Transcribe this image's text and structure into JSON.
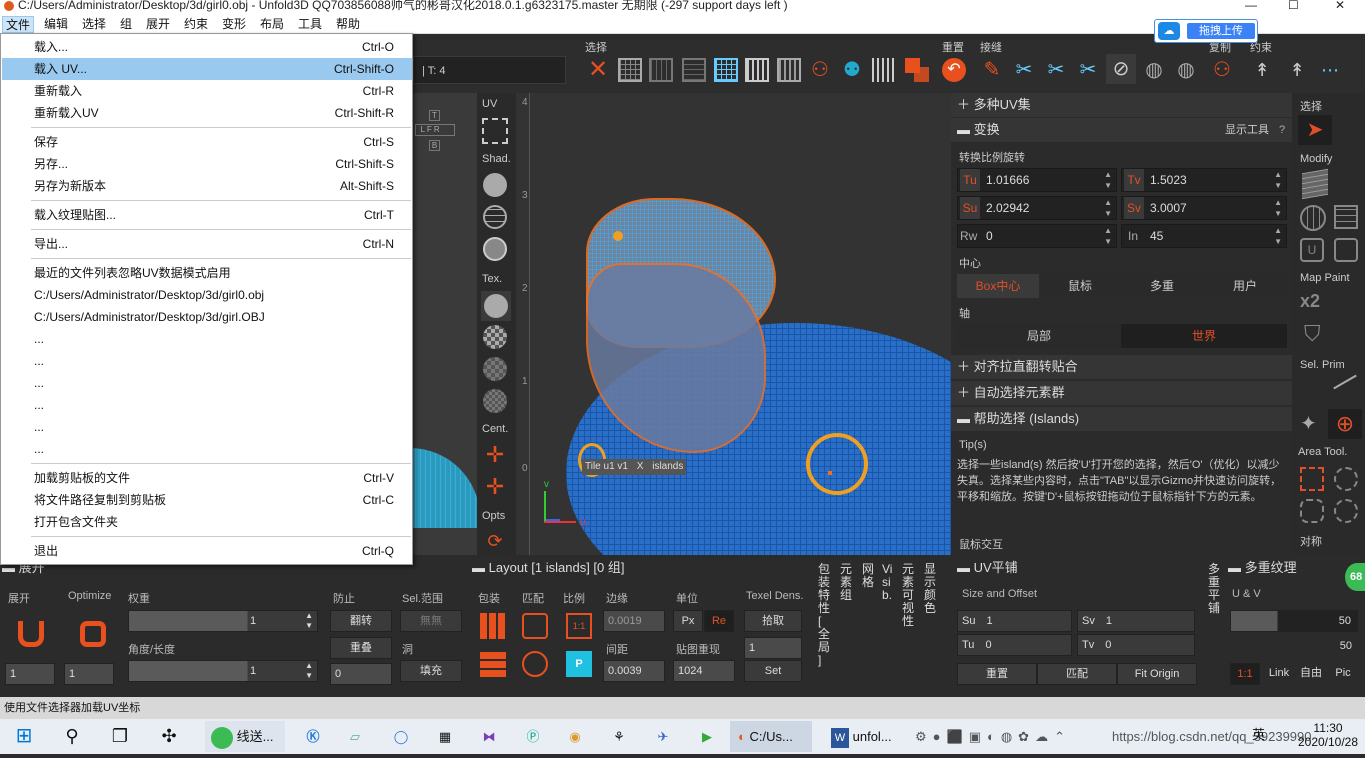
{
  "window": {
    "title": "C:/Users/Administrator/Desktop/3d/girl0.obj - Unfold3D QQ703856088帅气的彬哥汉化2018.0.1.g6323175.master 无期限 (-297 support days left )"
  },
  "menubar": [
    "文件",
    "编辑",
    "选择",
    "组",
    "展开",
    "约束",
    "变形",
    "布局",
    "工具",
    "帮助"
  ],
  "upload_badge": "拖拽上传",
  "toolbar": {
    "label_select": "选择",
    "label_reset": "重置",
    "label_connect": "接缝",
    "label_copy": "复制",
    "label_constraint": "约束",
    "tcount": "| T: 4"
  },
  "file_menu": {
    "items": [
      {
        "label": "载入...",
        "shortcut": "Ctrl-O"
      },
      {
        "label": "载入 UV...",
        "shortcut": "Ctrl-Shift-O"
      },
      {
        "label": "重新载入",
        "shortcut": "Ctrl-R"
      },
      {
        "label": "重新载入UV",
        "shortcut": "Ctrl-Shift-R"
      },
      {
        "label": "保存",
        "shortcut": "Ctrl-S"
      },
      {
        "label": "另存...",
        "shortcut": "Ctrl-Shift-S"
      },
      {
        "label": "另存为新版本",
        "shortcut": "Alt-Shift-S"
      },
      {
        "label": "载入纹理贴图...",
        "shortcut": "Ctrl-T"
      },
      {
        "label": "导出...",
        "shortcut": "Ctrl-N"
      },
      {
        "label": "最近的文件列表忽略UV数据模式启用",
        "shortcut": ""
      },
      {
        "label": "C:/Users/Administrator/Desktop/3d/girl0.obj",
        "shortcut": ""
      },
      {
        "label": "C:/Users/Administrator/Desktop/3d/girl.OBJ",
        "shortcut": ""
      },
      {
        "label": "...",
        "shortcut": ""
      },
      {
        "label": "...",
        "shortcut": ""
      },
      {
        "label": "...",
        "shortcut": ""
      },
      {
        "label": "...",
        "shortcut": ""
      },
      {
        "label": "...",
        "shortcut": ""
      },
      {
        "label": "...",
        "shortcut": ""
      },
      {
        "label": "加载剪贴板的文件",
        "shortcut": "Ctrl-V"
      },
      {
        "label": "将文件路径复制到剪贴板",
        "shortcut": "Ctrl-C"
      },
      {
        "label": "打开包含文件夹",
        "shortcut": ""
      },
      {
        "label": "退出",
        "shortcut": "Ctrl-Q"
      }
    ]
  },
  "midtools": {
    "uv": "UV",
    "shad": "Shad.",
    "tex": "Tex.",
    "cent": "Cent.",
    "opts": "Opts"
  },
  "viewport": {
    "tile_label": "Tile u1 v1",
    "tile_x": "X",
    "tile_islands": "islands",
    "axis_v": "v",
    "axis_u": "u",
    "ruler": [
      "4",
      "3",
      "2",
      "1",
      "0"
    ]
  },
  "right_panel": {
    "multi_uv": "多种UV集",
    "transform": "变换",
    "show_tools": "显示工具",
    "help_q": "?",
    "transform_sub": "转换比例旋转",
    "tu_label": "Tu",
    "tu": "1.01666",
    "tv_label": "Tv",
    "tv": "1.5023",
    "su_label": "Su",
    "su": "2.02942",
    "sv_label": "Sv",
    "sv": "3.0007",
    "rw_label": "Rw",
    "rw": "0",
    "in_label": "In",
    "in": "45",
    "center": "中心",
    "center_opts": [
      "Box中心",
      "鼠标",
      "多重",
      "用户"
    ],
    "axis": "轴",
    "axis_opts": [
      "局部",
      "世界"
    ],
    "align": "对齐拉直翻转贴合",
    "auto_select": "自动选择元素群",
    "help_select": "帮助选择 (Islands)",
    "tips_label": "Tip(s)",
    "tips_text": "选择一些island(s) 然后按'U'打开您的选择，然后'O'（优化）以减少失真。选择某些内容时，点击\"TAB\"以显示Gizmo并快速访问旋转，平移和缩放。按键'D'+鼠标按钮拖动位于鼠标指针下方的元素。",
    "mouse_cross": "鼠标交互"
  },
  "far_right": {
    "select": "选择",
    "modify": "Modify",
    "map_paint": "Map Paint",
    "x2": "x2",
    "sel_prim": "Sel. Prim",
    "area_tool": "Area Tool.",
    "symmetry": "对称"
  },
  "bottom": {
    "unfold": "展开",
    "unfold_lbl": "展开",
    "optimize": "Optimize",
    "weight": "权重",
    "weight_val": "1",
    "angle": "角度/长度",
    "angle_val": "1",
    "prevent": "防止",
    "flip": "翻转",
    "overlap": "重叠",
    "sel_range": "Sel.范围",
    "none": "無無",
    "hole": "洞",
    "fill": "填充",
    "u1": "1",
    "u2": "1",
    "u3": "0",
    "layout": "Layout [1 islands] [0 组]",
    "pack": "包装",
    "match": "匹配",
    "scale": "比例",
    "margin": "边缘",
    "margin_val": "0.0019",
    "spacing": "间距",
    "spacing_val": "0.0039",
    "unit": "单位",
    "px": "Px",
    "re": "Re",
    "map_rep": "贴图重现",
    "map_rep_val": "1024",
    "texel": "Texel Dens.",
    "pick": "拾取",
    "texel_val": "1",
    "set": "Set",
    "v1": "包装特性[全局]",
    "v2": "元素组",
    "v3": "网格",
    "v4": "Visib.",
    "v5": "元素可视性",
    "v6": "显示颜色",
    "uvtile": "UV平铺",
    "size_offset": "Size and Offset",
    "btm_su": "Su",
    "btm_su_val": "1",
    "btm_sv": "Sv",
    "btm_sv_val": "1",
    "btm_tu": "Tu",
    "btm_tu_val": "0",
    "btm_tv": "Tv",
    "btm_tv_val": "0",
    "reset": "重置",
    "match2": "匹配",
    "fit_origin": "Fit Origin",
    "v7": "多重平铺",
    "multi_tex": "多重纹理",
    "uv_v": "U & V",
    "mt_val1": "50",
    "mt_val2": "50",
    "one_one": "1:1",
    "link": "Link",
    "free": "自由",
    "pic": "Pic",
    "badge": "68"
  },
  "status": "使用文件选择器加载UV坐标",
  "taskbar": {
    "item1": "线送...",
    "item2": "C:/Us...",
    "item3": "unfol...",
    "url": "https://blog.csdn.net/qq_39239990",
    "time": "11:30",
    "date": "2020/10/28",
    "lang": "英"
  },
  "colors": {
    "accent": "#e05a1e",
    "select_hl": "#99c9ef",
    "mesh_blue": "#2a6fc7",
    "orange": "#f0a020"
  }
}
